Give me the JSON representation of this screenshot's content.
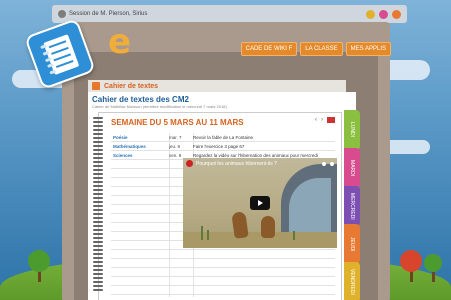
{
  "topbar": {
    "user_label": "Session de M. Pierson, Sirius",
    "icons": [
      "notification-icon",
      "settings-icon",
      "power-icon"
    ]
  },
  "brand": {
    "logo_letter": "e"
  },
  "nav": {
    "buttons": [
      "Cade de wiki F",
      "La classe",
      "Mes applis"
    ]
  },
  "cahier": {
    "header": "Cahier de textes",
    "title": "Cahier de textes des CM2",
    "subtitle": "Cahier de Mathilde Moisson (dernière modification le mercredi 7 mars 2018)"
  },
  "week": {
    "title": "Semaine du 5 mars au 11 mars",
    "prev_label": "‹",
    "next_label": "›"
  },
  "entries": [
    {
      "subject": "Poésie",
      "day": "mar. 7",
      "task": "Revoir la fable de La Fontaine"
    },
    {
      "subject": "Mathématiques",
      "day": "jeu. 8",
      "task": "Faire l'exercice 3 page 67"
    },
    {
      "subject": "Sciences",
      "day": "ven. 9",
      "task": "Regardez la vidéo sur l'hibernation des animaux pour mercredi"
    }
  ],
  "tabs": [
    {
      "label": "Lundi",
      "color": "#8bbf3f"
    },
    {
      "label": "Mardi",
      "color": "#d84c8f"
    },
    {
      "label": "Mercredi",
      "color": "#7e4fb3"
    },
    {
      "label": "Jeudi",
      "color": "#e77933"
    },
    {
      "label": "Vendredi",
      "color": "#e0b22b"
    }
  ],
  "video": {
    "title": "Pourquoi les animaux hibernent-ils ?"
  },
  "colors": {
    "accent_orange": "#e58a2b",
    "title_blue": "#1f5d97",
    "week_orange": "#d7621f"
  }
}
